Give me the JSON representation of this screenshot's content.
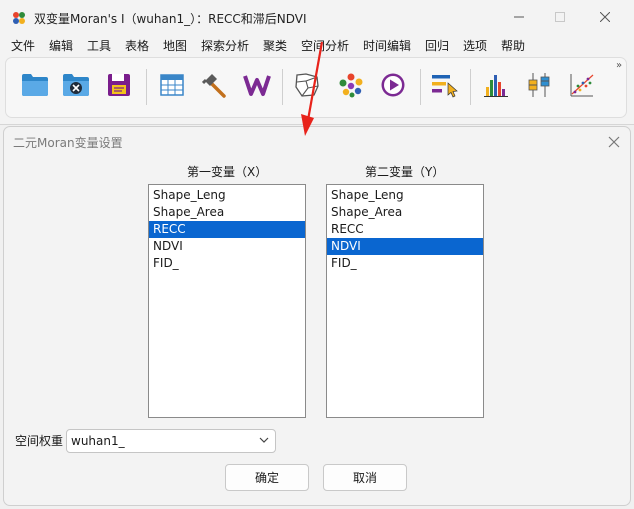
{
  "window": {
    "title": "双变量Moran's I（wuhan1_）：RECC和滞后NDVI"
  },
  "menu": [
    {
      "label": "文件"
    },
    {
      "label": "编辑"
    },
    {
      "label": "工具"
    },
    {
      "label": "表格"
    },
    {
      "label": "地图"
    },
    {
      "label": "探索分析"
    },
    {
      "label": "聚类"
    },
    {
      "label": "空间分析"
    },
    {
      "label": "时间编辑"
    },
    {
      "label": "回归"
    },
    {
      "label": "选项"
    },
    {
      "label": "帮助"
    }
  ],
  "toolbar": {
    "icons": [
      "open-folder-icon",
      "close-project-icon",
      "save-icon",
      "table-icon",
      "hammer-icon",
      "weights-icon",
      "map-icon",
      "cluster-icon",
      "play-icon",
      "select-icon",
      "histogram-icon",
      "boxplot-icon",
      "scatterplot-icon"
    ],
    "overflow": "»"
  },
  "dialog": {
    "title": "二元Moran变量设置",
    "first_var_label": "第一变量（X）",
    "second_var_label": "第二变量（Y）",
    "first_var_items": [
      "Shape_Leng",
      "Shape_Area",
      "RECC",
      "NDVI",
      "FID_"
    ],
    "first_var_selected": "RECC",
    "second_var_items": [
      "Shape_Leng",
      "Shape_Area",
      "RECC",
      "NDVI",
      "FID_"
    ],
    "second_var_selected": "NDVI",
    "weights_label": "空间权重",
    "weights_value": "wuhan1_",
    "ok_label": "确定",
    "cancel_label": "取消"
  },
  "colors": {
    "selection": "#0a66d0",
    "annotation_arrow": "#e8231b"
  }
}
